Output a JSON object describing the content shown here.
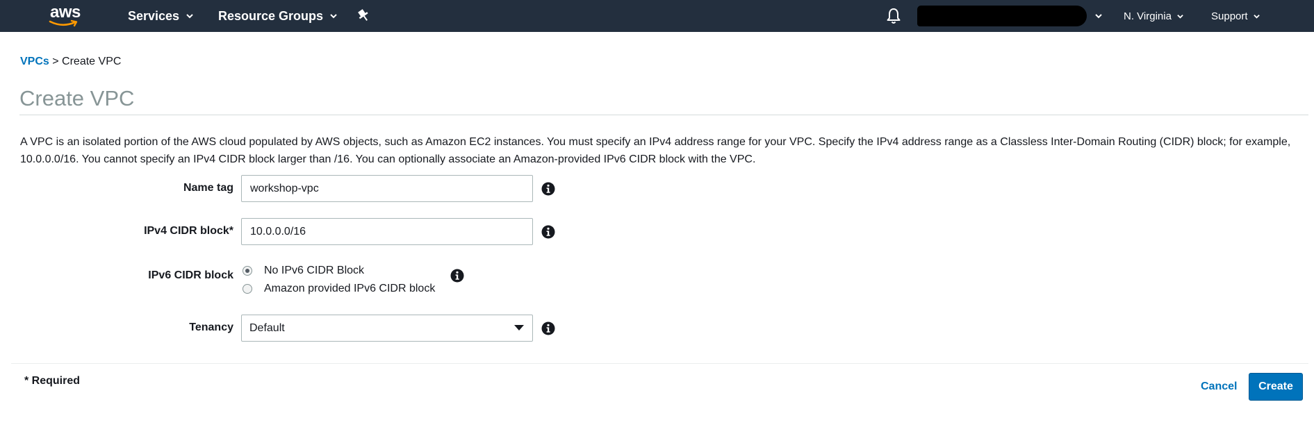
{
  "topnav": {
    "logo_text": "aws",
    "services_label": "Services",
    "resource_groups_label": "Resource Groups",
    "region_label": "N. Virginia",
    "support_label": "Support",
    "background_color": "#232f3e",
    "logo_accent_color": "#ff9900"
  },
  "breadcrumb": {
    "root_link": "VPCs",
    "separator": ">",
    "current": "Create VPC"
  },
  "page": {
    "title": "Create VPC",
    "description": "A VPC is an isolated portion of the AWS cloud populated by AWS objects, such as Amazon EC2 instances. You must specify an IPv4 address range for your VPC. Specify the IPv4 address range as a Classless Inter-Domain Routing (CIDR) block; for example, 10.0.0.0/16. You cannot specify an IPv4 CIDR block larger than /16. You can optionally associate an Amazon-provided IPv6 CIDR block with the VPC."
  },
  "form": {
    "name_tag": {
      "label": "Name tag",
      "value": "workshop-vpc"
    },
    "ipv4_cidr": {
      "label": "IPv4 CIDR block*",
      "value": "10.0.0.0/16"
    },
    "ipv6_cidr": {
      "label": "IPv6 CIDR block",
      "options": [
        "No IPv6 CIDR Block",
        "Amazon provided IPv6 CIDR block"
      ],
      "selected": "No IPv6 CIDR Block"
    },
    "tenancy": {
      "label": "Tenancy",
      "value": "Default"
    }
  },
  "footer": {
    "required_note": "* Required",
    "cancel_label": "Cancel",
    "create_label": "Create",
    "primary_color": "#0073bb"
  },
  "icons": [
    "aws-logo",
    "chevron-down-icon",
    "pin-icon",
    "bell-icon",
    "info-icon"
  ]
}
